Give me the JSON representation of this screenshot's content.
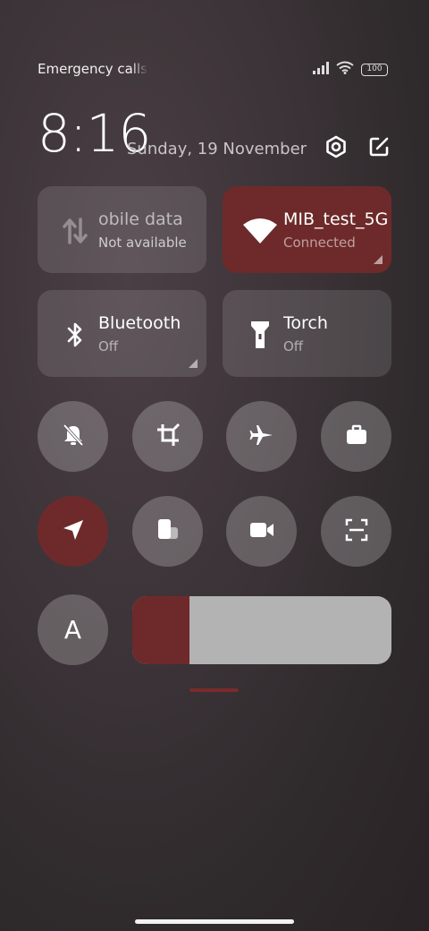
{
  "status": {
    "carrier_text": "Emergency calls o",
    "battery": "100"
  },
  "header": {
    "time": "8:16",
    "date": "Sunday, 19 November",
    "settings_icon": "gear-icon",
    "edit_icon": "edit-icon"
  },
  "tiles": {
    "mobile_data": {
      "title": "obile data",
      "subtitle": "Not available",
      "icon": "mobile-data-icon"
    },
    "wifi": {
      "title": "MIB_test_5G",
      "subtitle": "Connected",
      "icon": "wifi-icon"
    },
    "bluetooth": {
      "title": "Bluetooth",
      "subtitle": "Off",
      "icon": "bluetooth-icon"
    },
    "torch": {
      "title": "Torch",
      "subtitle": "Off",
      "icon": "torch-icon"
    }
  },
  "toggles": [
    {
      "name": "mute",
      "icon": "bell-off-icon",
      "active": false
    },
    {
      "name": "screenshot",
      "icon": "crop-icon",
      "active": false
    },
    {
      "name": "airplane",
      "icon": "airplane-icon",
      "active": false
    },
    {
      "name": "work",
      "icon": "briefcase-icon",
      "active": false
    },
    {
      "name": "location",
      "icon": "location-arrow-icon",
      "active": true
    },
    {
      "name": "floating-window",
      "icon": "floating-window-icon",
      "active": false
    },
    {
      "name": "screen-record",
      "icon": "video-camera-icon",
      "active": false
    },
    {
      "name": "scanner",
      "icon": "scan-icon",
      "active": false
    }
  ],
  "brightness": {
    "auto_label": "A",
    "level": 0.22
  },
  "colors": {
    "accent": "#6e2a2a",
    "tile_bg": "#4a4245",
    "slider_track": "#b3b3b3"
  }
}
